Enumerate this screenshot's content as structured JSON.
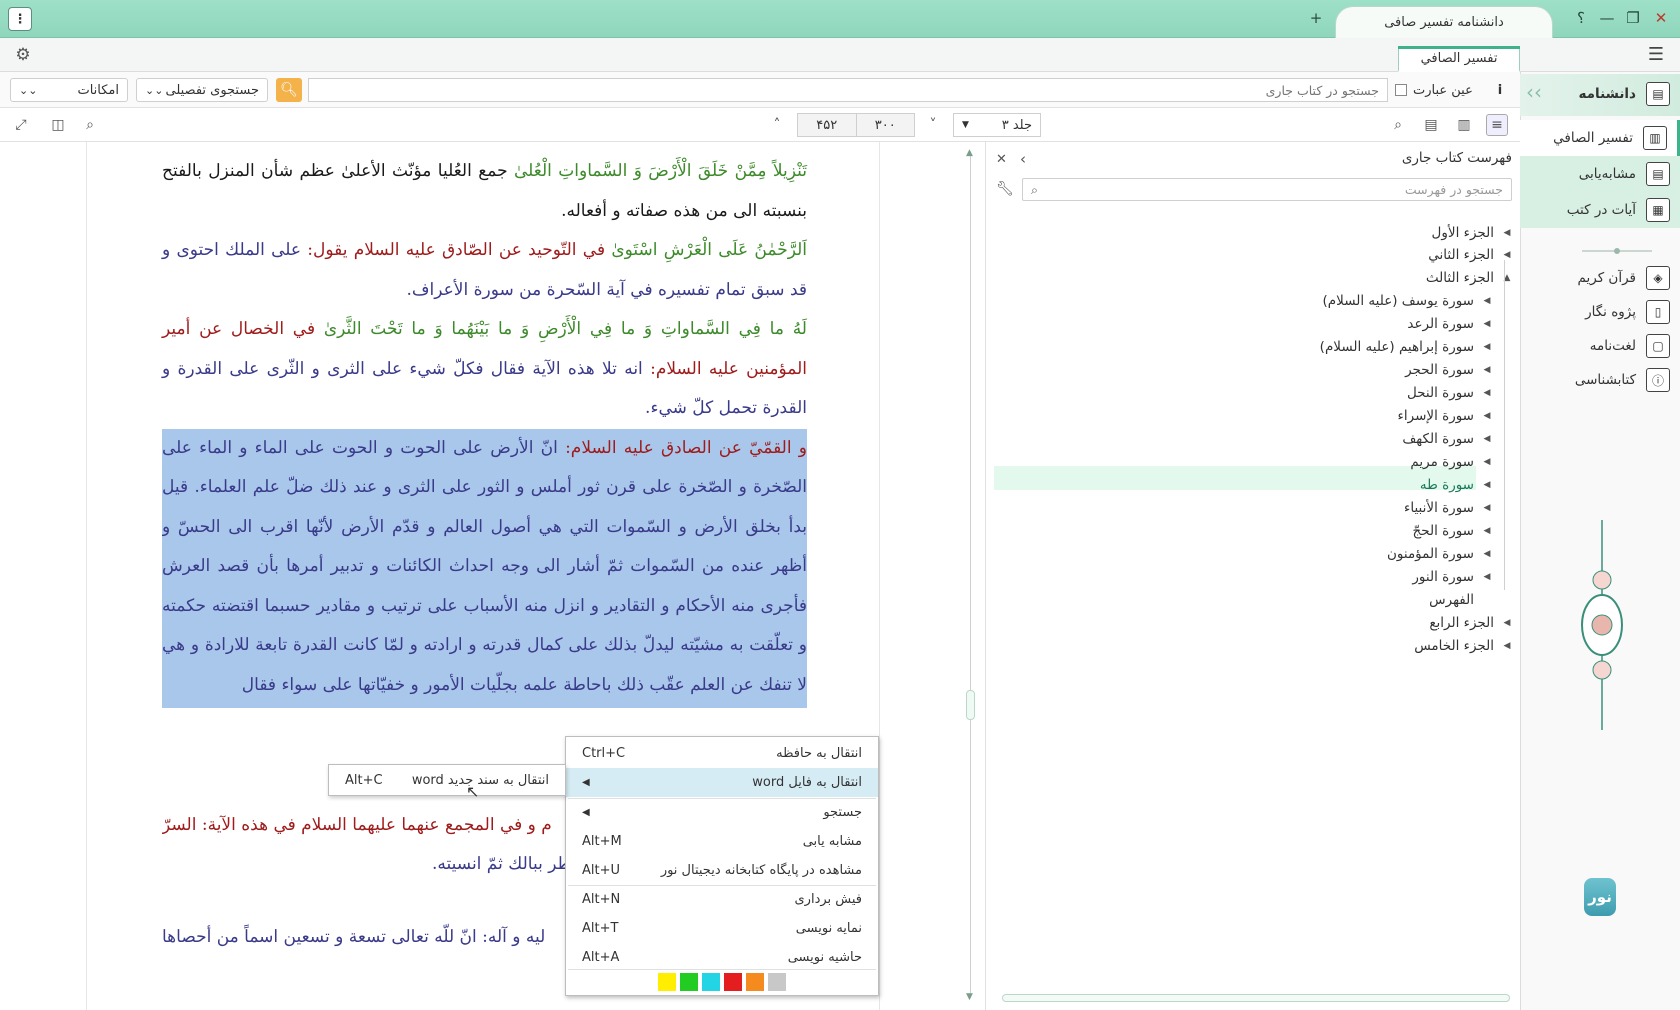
{
  "window": {
    "app_title": "دانشنامه تفسیر صافی",
    "buttons": {
      "close": "✕",
      "restore": "❐",
      "minimize": "—",
      "help": "؟",
      "new_tab": "+"
    }
  },
  "tabs": {
    "book": "تفسیر الصافي"
  },
  "search": {
    "placeholder": "جستجو در کتاب جاری",
    "exact_label": "عین عبارت",
    "advanced_label": "جستجوی تفصیلی",
    "options_label": "امکانات"
  },
  "nav": {
    "page_current": "۳۰۰",
    "page_total": "۴۵۲",
    "volume": "جلد ۳"
  },
  "text": {
    "p1_quran": "تَنْزِيلاً مِمَّنْ خَلَقَ الْأَرْضَ وَ السَّماواتِ الْعُلىٰ",
    "p1_rest": " جمع العُليا مؤنّث الأعلىٰ عظم شأن المنزل بالفتح بنسبته الى من هذه صفاته و أفعاله.",
    "p2_quran": "اَلرَّحْمٰنُ عَلَى الْعَرْشِ اسْتَوىٰ",
    "p2_red": " في التّوحيد عن الصّادق عليه السلام يقول:",
    "p2_rest": " على الملك احتوى و قد سبق تمام تفسيره في آية السّحرة من سورة الأعراف.",
    "p3_quran": "لَهُ ما فِي السَّماواتِ وَ ما فِي الْأَرْضِ وَ ما بَيْنَهُما وَ ما تَحْتَ الثَّرىٰ",
    "p3_red": " في الخصال عن أمير المؤمنين عليه السلام:",
    "p3_rest": " انه تلا هذه الآية فقال فكلّ شيء على الثرى و الثّرى على القدرة و القدرة تحمل كلّ شيء.",
    "p4_red": "و القمّيّ عن الصادق عليه السلام:",
    "p4_rest": " انّ الأرض على الحوت و الحوت على الماء و الماء على الصّخرة و الصّخرة على قرن ثور أملس و الثور على الثرى و عند ذلك ضلّ علم العلماء. قيل بدأ بخلق الأرض و السّموات التي هي أصول العالم و قدّم الأرض لأنّها اقرب الى الحسّ و أظهر عنده من السّموات ثمّ أشار الى وجه احداث الكائنات و تدبير أمرها بأن قصد العرش فأجرى منه الأحكام و التقادير و انزل منه الأسباب على ترتيب و مقادير حسبما اقتضته حكمته و تعلّقت به مشيّته ليدلّ بذلك على كمال قدرته و ارادته و لمّا كانت القدرة تابعة للارادة و هي لا تنفك عن العلم عقّب ذلك باحاطة علمه بجلّيات الأمور و خفيّاتها على سواء فقال",
    "p5_part1": "م و في المجمع عنهما عليهما السلام في هذه الآية: السرّ",
    "p5_part2": "طر ببالك ثمّ انسيته.",
    "p6_part": "ليه و آله: انّ للّه تعالى تسعة و تسعين اسماً من أحصاها"
  },
  "context_menu": {
    "items": [
      {
        "label": "انتقال به حافظه",
        "shortcut": "Ctrl+C"
      },
      {
        "label": "انتقال به فایل word",
        "shortcut": ""
      },
      {
        "label": "جستجو",
        "shortcut": ""
      },
      {
        "label": "مشابه یابی",
        "shortcut": "Alt+M"
      },
      {
        "label": "مشاهده در پایگاه کتابخانه دیجیتال نور",
        "shortcut": "Alt+U"
      },
      {
        "label": "فیش برداری",
        "shortcut": "Alt+N"
      },
      {
        "label": "نمایه نویسی",
        "shortcut": "Alt+T"
      },
      {
        "label": "حاشیه نویسی",
        "shortcut": "Alt+A"
      }
    ],
    "submenu": {
      "label": "انتقال به سند جدید word",
      "shortcut": "Alt+C"
    },
    "colors": [
      "#ffee00",
      "#22cc22",
      "#22d4e4",
      "#e41e1e",
      "#f58a1f",
      "#c8c8c8"
    ]
  },
  "toc": {
    "title": "فهرست کتاب جاری",
    "search_placeholder": "جستجو در فهرست",
    "items": [
      {
        "label": "الجزء الأول"
      },
      {
        "label": "الجزء الثاني"
      },
      {
        "label": "الجزء الثالث"
      },
      {
        "label": "سورة يوسف (عليه السلام)"
      },
      {
        "label": "سورة الرعد"
      },
      {
        "label": "سورة إبراهيم (عليه السلام)"
      },
      {
        "label": "سورة الحجر"
      },
      {
        "label": "سورة النحل"
      },
      {
        "label": "سورة الإسراء"
      },
      {
        "label": "سورة الكهف"
      },
      {
        "label": "سورة مريم"
      },
      {
        "label": "سورة طه"
      },
      {
        "label": "سورة الأنبياء"
      },
      {
        "label": "سورة الحجّ"
      },
      {
        "label": "سورة المؤمنون"
      },
      {
        "label": "سورة النور"
      },
      {
        "label": "الفهرس"
      },
      {
        "label": "الجزء الرابع"
      },
      {
        "label": "الجزء الخامس"
      }
    ]
  },
  "sidebar": {
    "header": "دانشنامه",
    "items": [
      {
        "label": "تفسیر الصافي",
        "icon": "books-icon"
      },
      {
        "label": "مشابه‌یابی",
        "icon": "similar-icon"
      },
      {
        "label": "آیات در کتب",
        "icon": "verses-icon"
      },
      {
        "label": "قرآن کریم",
        "icon": "quran-icon"
      },
      {
        "label": "پژوه نگار",
        "icon": "research-icon"
      },
      {
        "label": "لغت‌نامه",
        "icon": "dictionary-icon"
      },
      {
        "label": "کتابشناسی",
        "icon": "bibliography-icon"
      }
    ],
    "logo_text": "نور"
  },
  "colors": {
    "accent": "#3cb38a",
    "titlebar": "#9ee0c8",
    "selection": "#a9c7ea",
    "toc_highlight": "#e4f9ee",
    "search_button": "#f4b24a"
  }
}
